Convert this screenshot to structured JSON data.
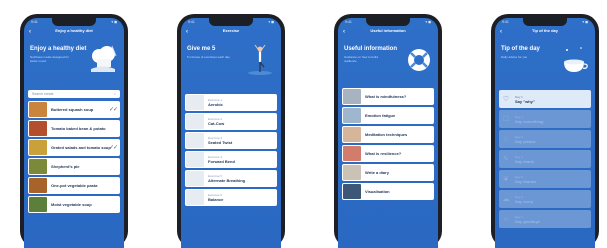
{
  "colors": {
    "brand_blue": "#2e6fc8",
    "card": "#ffffff",
    "phone_frame": "#1c1f26"
  },
  "status": {
    "time": "9:41",
    "icons": "▾ ◼"
  },
  "screens": [
    {
      "nav_title": "Enjoy a healthy diet",
      "hero_title": "Enjoy a healthy diet",
      "hero_subtitle": "Nutritious meals designed for better mood",
      "search_placeholder": "Search meals",
      "items": [
        {
          "title": "Buttered squash soup",
          "done": "✓✓"
        },
        {
          "title": "Tomato baked bean & potato",
          "done": ""
        },
        {
          "title": "Grated salads and tomato soup",
          "done": "✓✓"
        },
        {
          "title": "Shepherd's pie",
          "done": ""
        },
        {
          "title": "One-pot vegetable pasta",
          "done": ""
        },
        {
          "title": "Moist vegetable soup",
          "done": ""
        }
      ]
    },
    {
      "nav_title": "Exercise",
      "hero_title": "Give me 5",
      "hero_subtitle": "5 minutes of exercises each day",
      "items": [
        {
          "label": "Exercise 1",
          "title": "Aerobic"
        },
        {
          "label": "Exercise 2",
          "title": "Cat-Cow"
        },
        {
          "label": "Exercise 3",
          "title": "Seated Twist"
        },
        {
          "label": "Exercise 4",
          "title": "Forward Bend"
        },
        {
          "label": "Exercise 5",
          "title": "Alternate Breathing"
        },
        {
          "label": "Exercise 6",
          "title": "Balance"
        }
      ]
    },
    {
      "nav_title": "Useful information",
      "hero_title": "Useful information",
      "hero_subtitle": "Guidance on how to build resilience",
      "items": [
        {
          "title": "What is mindfulness?"
        },
        {
          "title": "Emotion fatigue"
        },
        {
          "title": "Meditation techniques"
        },
        {
          "title": "What is resilience?"
        },
        {
          "title": "Write a diary"
        },
        {
          "title": "Visualisation"
        }
      ]
    },
    {
      "nav_title": "Tip of the day",
      "hero_title": "Tip of the day",
      "hero_subtitle": "Daily advice for you",
      "items": [
        {
          "label": "Day 1",
          "title": "Say \"why\"",
          "active": true
        },
        {
          "label": "Day 2",
          "title": "Say something",
          "active": false
        },
        {
          "label": "Day 3",
          "title": "Say please",
          "active": false
        },
        {
          "label": "Day 4",
          "title": "Say thank",
          "active": false
        },
        {
          "label": "Day 5",
          "title": "Say thanks",
          "active": false
        },
        {
          "label": "Day 6",
          "title": "Say sorry",
          "active": false
        },
        {
          "label": "Day 7",
          "title": "Say goodbye",
          "active": false
        }
      ]
    }
  ]
}
